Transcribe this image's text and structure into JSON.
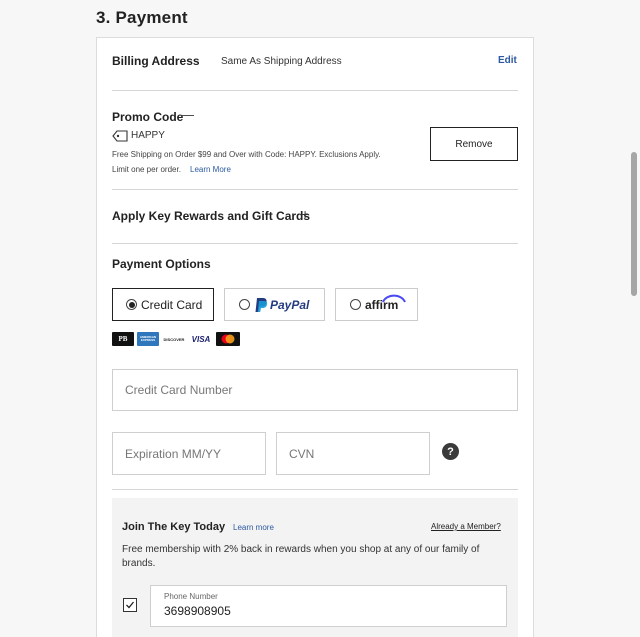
{
  "section": {
    "title": "3. Payment"
  },
  "billing": {
    "label": "Billing Address",
    "value": "Same As Shipping Address",
    "edit_label": "Edit"
  },
  "promo": {
    "label": "Promo Code",
    "toggle_glyph": "—",
    "code": "HAPPY",
    "description": "Free Shipping on Order $99 and Over with Code: HAPPY. Exclusions Apply.",
    "limit_text": "Limit one per order.",
    "learn_more": "Learn More",
    "remove_label": "Remove"
  },
  "rewards": {
    "label": "Apply Key Rewards and Gift Cards",
    "toggle_glyph": "+"
  },
  "payment_options": {
    "label": "Payment Options",
    "options": [
      {
        "label": "Credit Card",
        "selected": true
      },
      {
        "label": "PayPal",
        "selected": false
      },
      {
        "label": "affirm",
        "selected": false
      }
    ],
    "card_brands": [
      "PB",
      "AMERICAN EXPRESS",
      "DISCOVER",
      "VISA",
      "mastercard"
    ]
  },
  "card_form": {
    "number_placeholder": "Credit Card Number",
    "expiration_placeholder": "Expiration MM/YY",
    "cvn_placeholder": "CVN",
    "help_glyph": "?"
  },
  "key": {
    "title": "Join The Key Today",
    "learn_more": "Learn more",
    "already_member": "Already a Member?",
    "description": "Free membership with 2% back in rewards when you shop at any of our family of brands.",
    "phone_label": "Phone Number",
    "phone_value": "3698908905",
    "checked": true
  },
  "colors": {
    "link": "#2c5aa0",
    "paypal_dark": "#253b80",
    "paypal_light": "#179bd7"
  }
}
